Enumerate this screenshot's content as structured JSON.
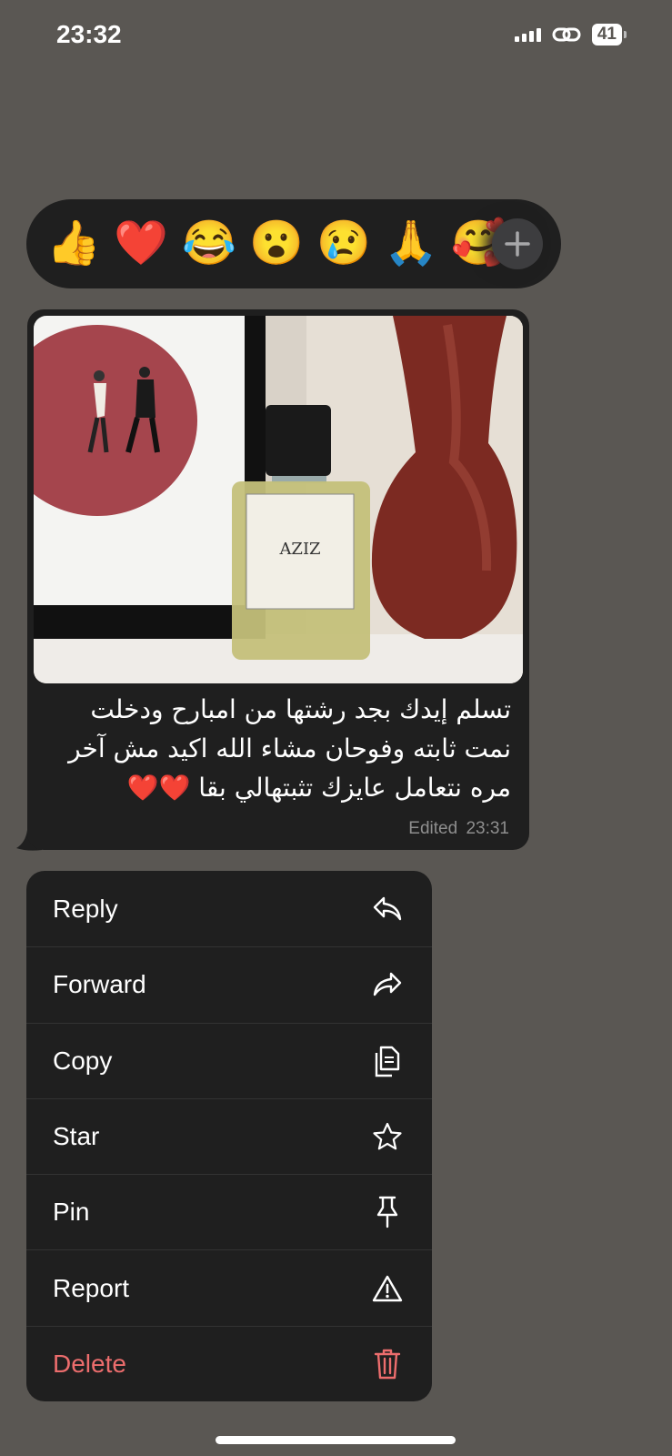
{
  "status_bar": {
    "time": "23:32",
    "battery": "41"
  },
  "reactions": [
    {
      "emoji": "👍",
      "name": "thumbs-up"
    },
    {
      "emoji": "❤️",
      "name": "red-heart"
    },
    {
      "emoji": "😂",
      "name": "tears-of-joy"
    },
    {
      "emoji": "😮",
      "name": "open-mouth"
    },
    {
      "emoji": "😢",
      "name": "crying"
    },
    {
      "emoji": "🙏",
      "name": "folded-hands"
    },
    {
      "emoji": "🥰",
      "name": "smiling-hearts"
    }
  ],
  "message": {
    "text_line1": "تسلم إيدك بجد رشتها من امبارح ودخلت",
    "text_line2": "نمت ثابته  وفوحان مشاء الله اكيد مش آخر",
    "text_line3": "مره نتعامل عايزك تثبتهالي بقا ❤️❤️",
    "edited_label": "Edited",
    "time": "23:31",
    "photo": {
      "bottle_label": "AZIZ"
    }
  },
  "menu": {
    "reply": "Reply",
    "forward": "Forward",
    "copy": "Copy",
    "star": "Star",
    "pin": "Pin",
    "report": "Report",
    "delete": "Delete"
  },
  "colors": {
    "background": "#5a5753",
    "surface": "#1f1f1f",
    "danger": "#ec6d6d"
  }
}
